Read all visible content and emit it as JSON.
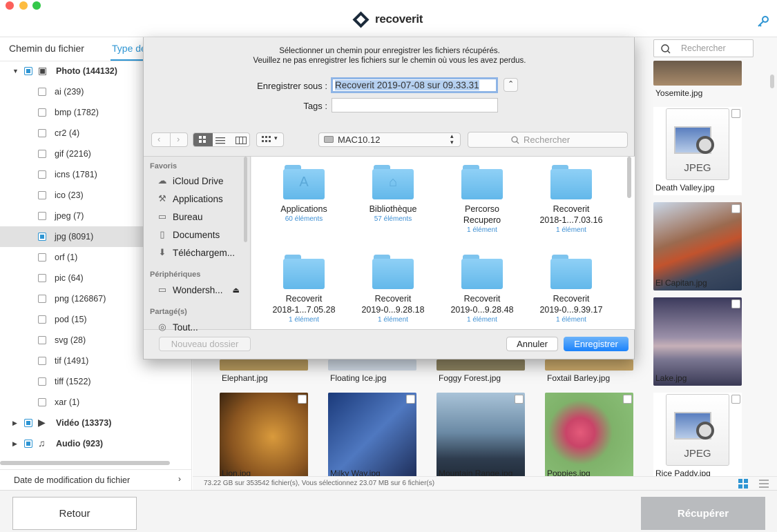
{
  "app": {
    "name": "recoverit"
  },
  "sidebar": {
    "tabs": [
      "Chemin du fichier",
      "Type de fichier"
    ],
    "tree": [
      {
        "label": "Photo (144132)",
        "bold": true,
        "checked": true
      },
      {
        "label": "ai (239)"
      },
      {
        "label": "bmp (1782)"
      },
      {
        "label": "cr2 (4)"
      },
      {
        "label": "gif (2216)"
      },
      {
        "label": "icns (1781)"
      },
      {
        "label": "ico (23)"
      },
      {
        "label": "jpeg (7)"
      },
      {
        "label": "jpg (8091)",
        "checked": true,
        "selected": true
      },
      {
        "label": "orf (1)"
      },
      {
        "label": "pic (64)"
      },
      {
        "label": "png (126867)"
      },
      {
        "label": "pod (15)"
      },
      {
        "label": "svg (28)"
      },
      {
        "label": "tif (1491)"
      },
      {
        "label": "tiff (1522)"
      },
      {
        "label": "xar (1)"
      },
      {
        "label": "Vidéo (13373)",
        "bold": true,
        "checked": true
      },
      {
        "label": "Audio (923)",
        "bold": true,
        "checked": true
      }
    ],
    "filter_label": "Date de modification du fichier"
  },
  "search": {
    "placeholder": "Rechercher"
  },
  "grid": {
    "items": [
      {
        "name": "Yosemite.jpg"
      },
      {
        "name": "Death Valley.jpg",
        "format": "JPEG"
      },
      {
        "name": "El Capitan.jpg"
      },
      {
        "name": "Elephant.jpg"
      },
      {
        "name": "Floating Ice.jpg"
      },
      {
        "name": "Foggy Forest.jpg"
      },
      {
        "name": "Foxtail Barley.jpg"
      },
      {
        "name": "Lake.jpg"
      },
      {
        "name": "Lion.jpg"
      },
      {
        "name": "Milky Way.jpg"
      },
      {
        "name": "Mountain Range.jpg"
      },
      {
        "name": "Poppies.jpg"
      },
      {
        "name": "Rice Paddy.jpg",
        "format": "JPEG"
      }
    ]
  },
  "status": "73.22 GB sur 353542 fichier(s), Vous sélectionnez 23.07 MB sur 6 fichier(s)",
  "buttons": {
    "back": "Retour",
    "recover": "Récupérer"
  },
  "dialog": {
    "message_line1": "Sélectionner un chemin pour enregistrer les fichiers récupérés.",
    "message_line2": "Veuillez ne pas enregistrer les fichiers sur le chemin où vous les avez perdus.",
    "save_as_label": "Enregistrer sous :",
    "save_as_value": "Recoverit 2019-07-08 sur 09.33.31",
    "tags_label": "Tags :",
    "location": "MAC10.12",
    "search_placeholder": "Rechercher",
    "favorites_header": "Favoris",
    "favorites": [
      "iCloud Drive",
      "Applications",
      "Bureau",
      "Documents",
      "Téléchargem..."
    ],
    "devices_header": "Périphériques",
    "devices": [
      "Wondersh..."
    ],
    "shared_header": "Partagé(s)",
    "shared": [
      "Tout..."
    ],
    "folders": [
      {
        "name": "Applications",
        "count": "60 éléments"
      },
      {
        "name": "Bibliothèque",
        "count": "57 éléments"
      },
      {
        "name": "Percorso\nRecupero",
        "count": "1 élément"
      },
      {
        "name": "Recoverit\n2018-1...7.03.16",
        "count": "1 élément"
      },
      {
        "name": "Recoverit\n2018-1...7.05.28",
        "count": "1 élément"
      },
      {
        "name": "Recoverit\n2019-0...9.28.18",
        "count": "1 élément"
      },
      {
        "name": "Recoverit\n2019-0...9.28.48",
        "count": "1 élément"
      },
      {
        "name": "Recoverit\n2019-0...9.39.17",
        "count": "1 élément"
      }
    ],
    "new_folder": "Nouveau dossier",
    "cancel": "Annuler",
    "save": "Enregistrer"
  }
}
